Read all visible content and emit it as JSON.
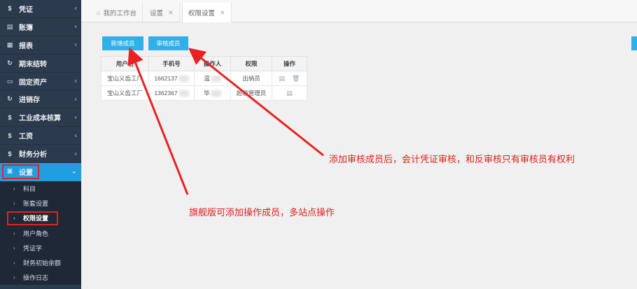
{
  "sidebar": {
    "items": [
      {
        "label": "凭证",
        "icon": "$"
      },
      {
        "label": "账簿",
        "icon": "▤"
      },
      {
        "label": "报表",
        "icon": "▦"
      },
      {
        "label": "期末结转",
        "icon": "↻"
      },
      {
        "label": "固定资产",
        "icon": "▭"
      },
      {
        "label": "进销存",
        "icon": "↻"
      },
      {
        "label": "工业成本核算",
        "icon": "$"
      },
      {
        "label": "工资",
        "icon": "$"
      },
      {
        "label": "财务分析",
        "icon": "$"
      }
    ],
    "active": {
      "label": "设置",
      "icon": "⌘"
    },
    "sub_items": [
      "科目",
      "账套设置",
      "权限设置",
      "用户角色",
      "凭证字",
      "财务初始余额",
      "操作日志"
    ]
  },
  "tabs": {
    "home": "我的工作台",
    "settings": "设置",
    "permissions": "权限设置"
  },
  "toolbar": {
    "add_member": "新增成员",
    "audit_member": "审核成员"
  },
  "table": {
    "headers": [
      "用户名",
      "手机号",
      "操作人",
      "权限",
      "操作"
    ],
    "rows": [
      {
        "user": "宝山义齿工厂",
        "phone": "1662137",
        "operator": "温",
        "role": "出纳员"
      },
      {
        "user": "宝山义齿工厂",
        "phone": "1362367",
        "operator": "毕",
        "role": "超级管理员"
      }
    ]
  },
  "annotations": {
    "audit_note": "添加审核成员后，会计凭证审核，和反审核只有审核员有权利",
    "add_note": "旗舰版可添加操作成员，多站点操作"
  },
  "colors": {
    "sidebar_bg": "#2c3a4d",
    "accent": "#1f9ee0",
    "button": "#2fb0ea",
    "annotation": "#e02020"
  }
}
